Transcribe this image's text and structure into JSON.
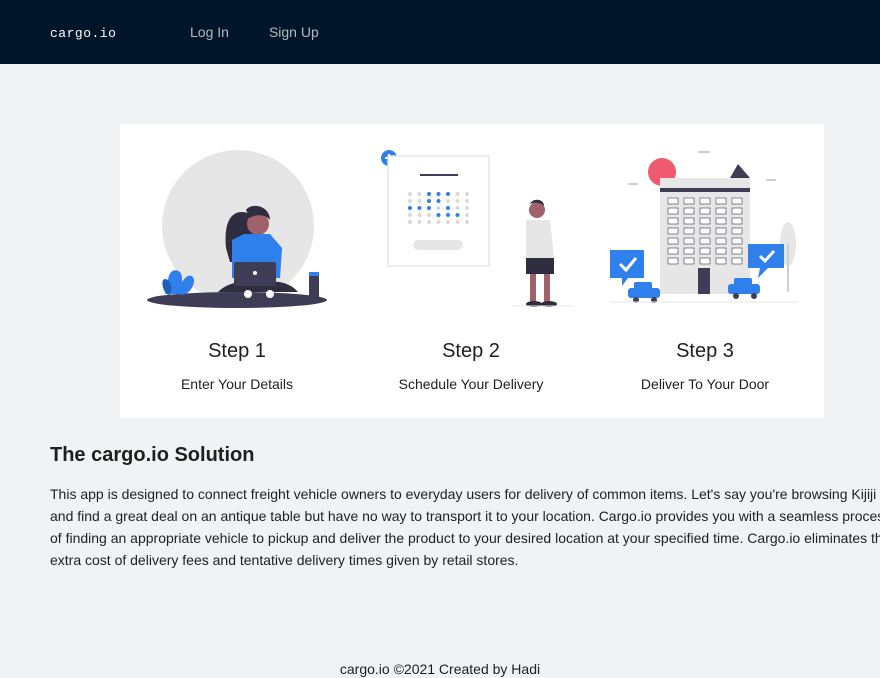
{
  "header": {
    "logo": "cargo.io",
    "nav": [
      {
        "label": "Log In"
      },
      {
        "label": "Sign Up"
      }
    ]
  },
  "steps": [
    {
      "title": "Step 1",
      "subtitle": "Enter Your Details",
      "illustration": "person-with-laptop"
    },
    {
      "title": "Step 2",
      "subtitle": "Schedule Your Delivery",
      "illustration": "calendar-and-person"
    },
    {
      "title": "Step 3",
      "subtitle": "Deliver To Your Door",
      "illustration": "building-and-cars"
    }
  ],
  "solution": {
    "title": "The cargo.io Solution",
    "lines": [
      "This app is designed to connect freight vehicle owners to everyday users for delivery of common items. Let's say you're browsing Kijiji",
      "and find a great deal on an antique table but have no way to transport it to your location. Cargo.io provides you with a seamless process",
      "of finding an appropriate vehicle to pickup and deliver the product to your desired location at your specified time. Cargo.io eliminates the",
      "extra cost of delivery fees and tentative delivery times given by retail stores."
    ]
  },
  "footer": {
    "text": "cargo.io ©2021 Created by Hadi"
  },
  "colors": {
    "header_bg": "#001529",
    "accent": "#2f80ed",
    "page_bg": "#f0f2f5",
    "highlight": "#f05a6e"
  }
}
